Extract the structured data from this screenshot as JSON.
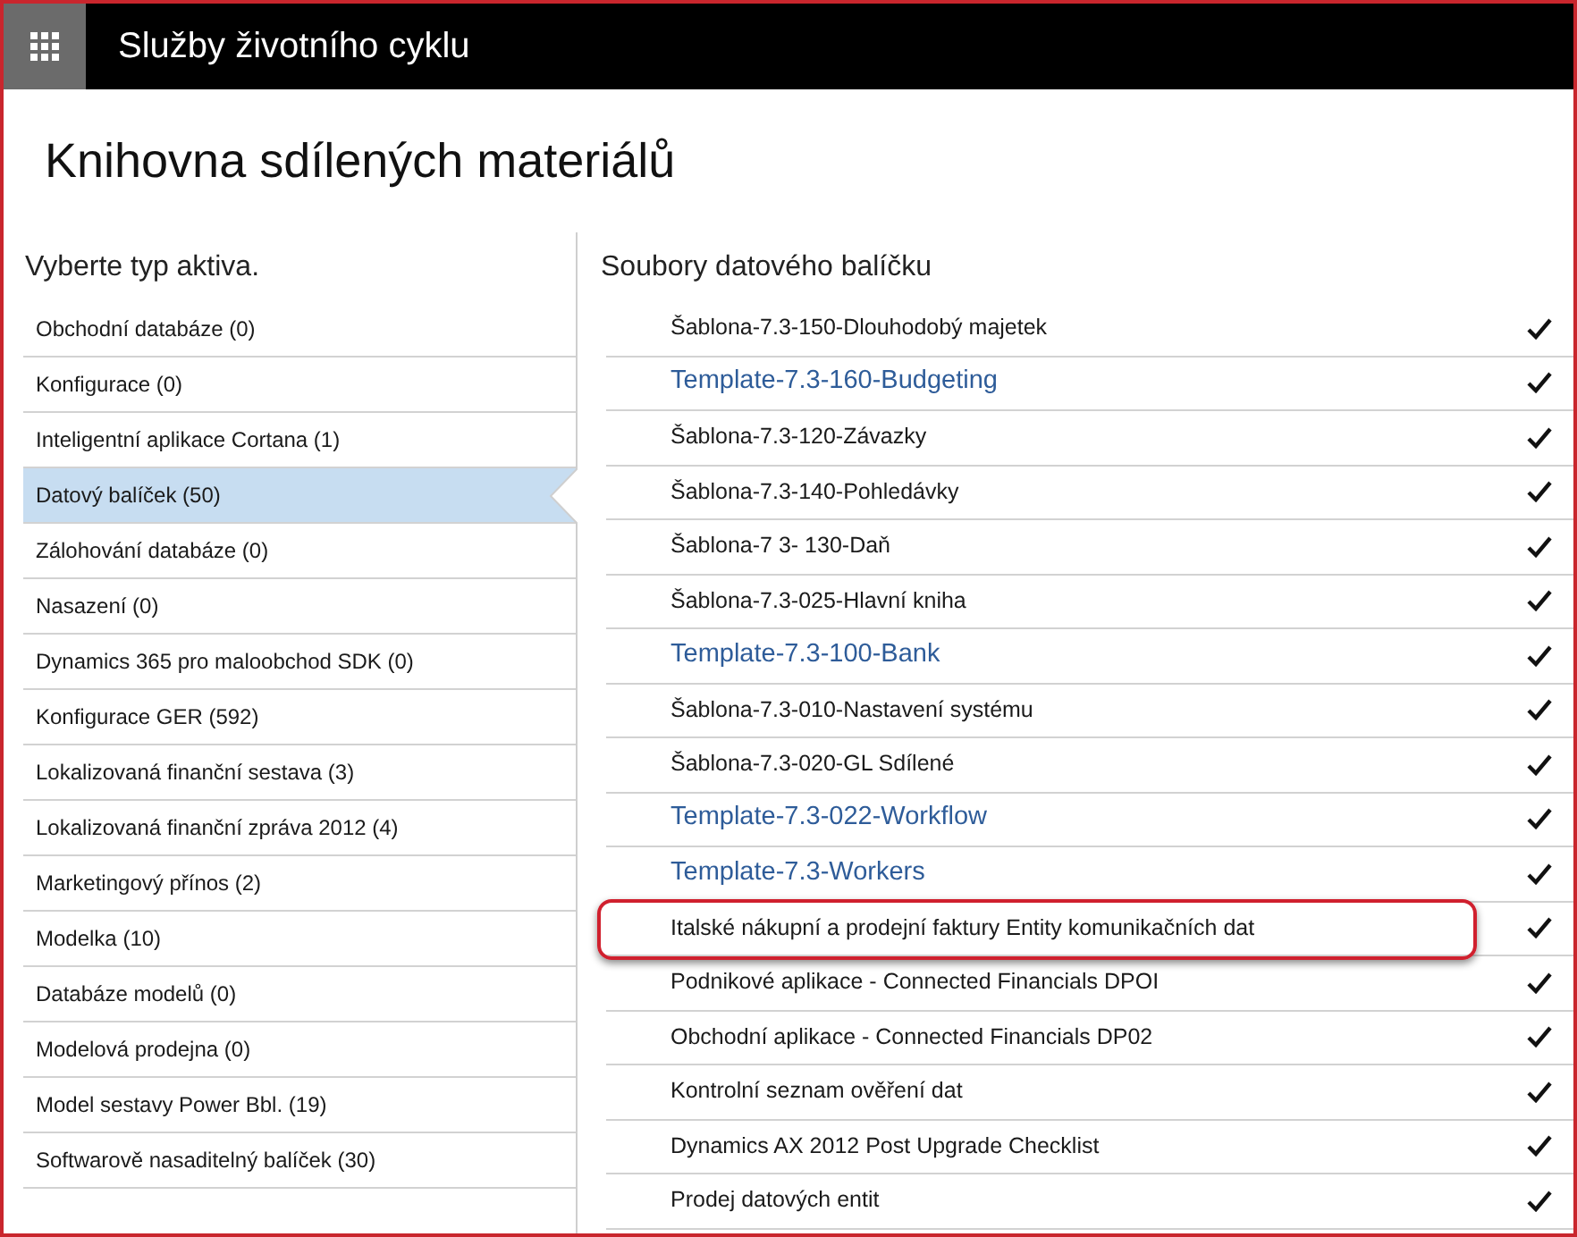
{
  "header": {
    "title": "Služby životního cyklu"
  },
  "page": {
    "title": "Knihovna sdílených materiálů"
  },
  "asset_types": {
    "heading": "Vyberte typ aktiva.",
    "items": [
      {
        "label": "Obchodní databáze (0)",
        "selected": false
      },
      {
        "label": "Konfigurace (0)",
        "selected": false
      },
      {
        "label": "Inteligentní aplikace Cortana (1)",
        "selected": false
      },
      {
        "label": "Datový balíček (50)",
        "selected": true
      },
      {
        "label": "Zálohování databáze (0)",
        "selected": false
      },
      {
        "label": "Nasazení (0)",
        "selected": false
      },
      {
        "label": "Dynamics 365 pro maloobchod SDK (0)",
        "selected": false
      },
      {
        "label": "Konfigurace GER (592)",
        "selected": false
      },
      {
        "label": "Lokalizovaná finanční sestava (3)",
        "selected": false
      },
      {
        "label": "Lokalizovaná finanční zpráva 2012 (4)",
        "selected": false
      },
      {
        "label": "Marketingový přínos (2)",
        "selected": false
      },
      {
        "label": "Modelka (10)",
        "selected": false
      },
      {
        "label": "Databáze modelů (0)",
        "selected": false
      },
      {
        "label": "Modelová prodejna (0)",
        "selected": false
      },
      {
        "label": "Model sestavy Power Bbl. (19)",
        "selected": false
      },
      {
        "label": "Softwarově nasaditelný balíček (30)",
        "selected": false
      }
    ]
  },
  "files": {
    "heading": "Soubory datového balíčku",
    "items": [
      {
        "name": "Šablona-7.3-150-Dlouhodobý majetek",
        "kind": "plain",
        "checked": true,
        "highlighted": false
      },
      {
        "name": "Template-7.3-160-Budgeting",
        "kind": "link",
        "checked": true,
        "highlighted": false
      },
      {
        "name": "Šablona-7.3-120-Závazky",
        "kind": "plain",
        "checked": true,
        "highlighted": false
      },
      {
        "name": "Šablona-7.3-140-Pohledávky",
        "kind": "plain",
        "checked": true,
        "highlighted": false
      },
      {
        "name": "Šablona-7 3- 130-Daň",
        "kind": "plain",
        "checked": true,
        "highlighted": false
      },
      {
        "name": "Šablona-7.3-025-Hlavní kniha",
        "kind": "plain",
        "checked": true,
        "highlighted": false
      },
      {
        "name": "Template-7.3-100-Bank",
        "kind": "link",
        "checked": true,
        "highlighted": false
      },
      {
        "name": "Šablona-7.3-010-Nastavení systému",
        "kind": "plain",
        "checked": true,
        "highlighted": false
      },
      {
        "name": "Šablona-7.3-020-GL Sdílené",
        "kind": "plain",
        "checked": true,
        "highlighted": false
      },
      {
        "name": "Template-7.3-022-Workflow",
        "kind": "link",
        "checked": true,
        "highlighted": false
      },
      {
        "name": "Template-7.3-Workers",
        "kind": "link",
        "checked": true,
        "highlighted": false
      },
      {
        "name": "Italské nákupní a prodejní faktury Entity komunikačních dat",
        "kind": "plain",
        "checked": true,
        "highlighted": true
      },
      {
        "name": "Podnikové aplikace - Connected Financials DPOI",
        "kind": "plain",
        "checked": true,
        "highlighted": false
      },
      {
        "name": "Obchodní aplikace - Connected Financials DP02",
        "kind": "plain",
        "checked": true,
        "highlighted": false
      },
      {
        "name": "Kontrolní seznam ověření dat",
        "kind": "plain",
        "checked": true,
        "highlighted": false
      },
      {
        "name": "Dynamics AX 2012 Post Upgrade Checklist",
        "kind": "plain",
        "checked": true,
        "highlighted": false
      },
      {
        "name": "Prodej datových entit",
        "kind": "plain",
        "checked": true,
        "highlighted": false
      }
    ]
  }
}
